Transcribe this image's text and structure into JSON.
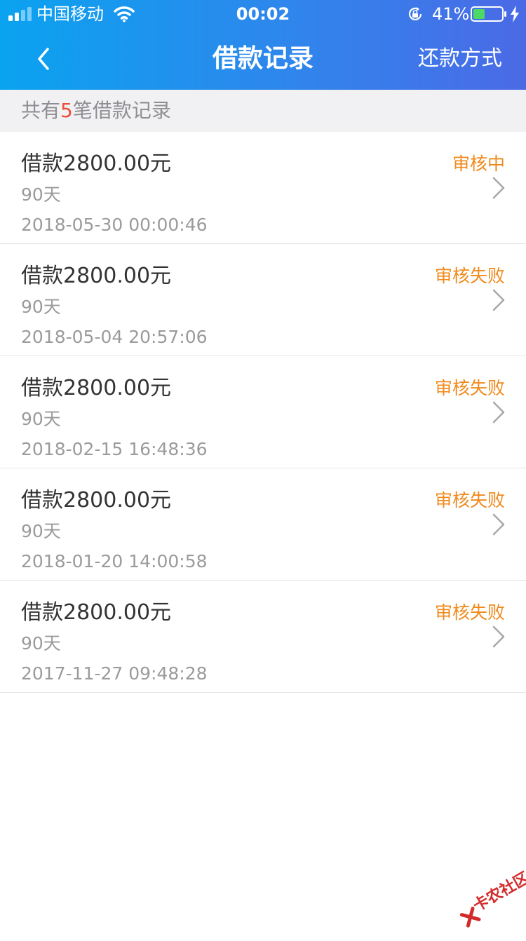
{
  "status_bar": {
    "carrier": "中国移动",
    "time": "00:02",
    "battery_percent": "41%",
    "battery_level": 0.41
  },
  "nav": {
    "title": "借款记录",
    "right_action": "还款方式"
  },
  "summary": {
    "prefix": "共有",
    "count": "5",
    "suffix": "笔借款记录"
  },
  "records": [
    {
      "amount": "借款2800.00元",
      "term": "90天",
      "date": "2018-05-30 00:00:46",
      "status": "审核中"
    },
    {
      "amount": "借款2800.00元",
      "term": "90天",
      "date": "2018-05-04 20:57:06",
      "status": "审核失败"
    },
    {
      "amount": "借款2800.00元",
      "term": "90天",
      "date": "2018-02-15 16:48:36",
      "status": "审核失败"
    },
    {
      "amount": "借款2800.00元",
      "term": "90天",
      "date": "2018-01-20 14:00:58",
      "status": "审核失败"
    },
    {
      "amount": "借款2800.00元",
      "term": "90天",
      "date": "2017-11-27 09:48:28",
      "status": "审核失败"
    }
  ],
  "watermark": {
    "text": "卡农社区"
  },
  "colors": {
    "header_start": "#0aa3f0",
    "header_end": "#4b6ae6",
    "status_orange": "#f08a1c",
    "count_red": "#f04b3a",
    "battery_green": "#4cd964"
  },
  "icons": [
    "signal-icon",
    "wifi-icon",
    "rotation-lock-icon",
    "battery-icon",
    "charging-bolt-icon",
    "back-chevron-icon",
    "chevron-right-icon"
  ]
}
